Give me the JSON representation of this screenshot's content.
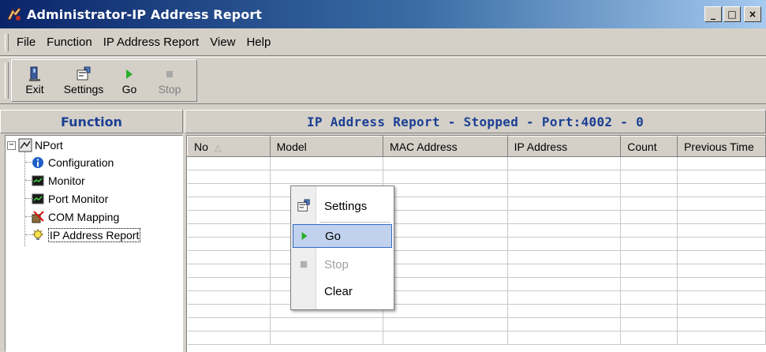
{
  "window": {
    "title": "Administrator-IP Address Report",
    "controls": {
      "minimize": "_",
      "maximize": "□",
      "close": "×"
    }
  },
  "menu": {
    "items": [
      {
        "label": "File",
        "accel": "F"
      },
      {
        "label": "Function",
        "accel": "F"
      },
      {
        "label": "IP Address Report",
        "accel": "I"
      },
      {
        "label": "View",
        "accel": "V"
      },
      {
        "label": "Help",
        "accel": "H"
      }
    ]
  },
  "toolbar": {
    "exit_label": "Exit",
    "settings_label": "Settings",
    "go_label": "Go",
    "stop_label": "Stop",
    "stop_disabled": true
  },
  "left_panel": {
    "header": "Function",
    "tree": {
      "root": "NPort",
      "expander": "−",
      "children": [
        {
          "label": "Configuration",
          "icon": "info-icon"
        },
        {
          "label": "Monitor",
          "icon": "monitor-icon"
        },
        {
          "label": "Port Monitor",
          "icon": "port-monitor-icon"
        },
        {
          "label": "COM Mapping",
          "icon": "com-mapping-icon"
        },
        {
          "label": "IP Address Report",
          "icon": "lightbulb-icon",
          "selected": true
        }
      ]
    }
  },
  "right_panel": {
    "header": "IP Address Report - Stopped - Port:4002 - 0",
    "columns": [
      "No",
      "Model",
      "MAC Address",
      "IP Address",
      "Count",
      "Previous Time"
    ],
    "sort_column": "No",
    "sort_indicator": "△",
    "rows": []
  },
  "context_menu": {
    "items": [
      {
        "label": "Settings",
        "accel": "S",
        "icon": "settings-icon",
        "disabled": false,
        "highlighted": false
      },
      {
        "label": "Go",
        "accel": "G",
        "icon": "play-icon",
        "disabled": false,
        "highlighted": true
      },
      {
        "label": "Stop",
        "accel": "t",
        "icon": "stop-icon",
        "disabled": true,
        "highlighted": false
      },
      {
        "label": "Clear",
        "accel": "C",
        "icon": "",
        "disabled": false,
        "highlighted": false
      }
    ]
  },
  "colors": {
    "title_gradient_start": "#0a246a",
    "title_gradient_end": "#a6caf0",
    "panel_header_text": "#1c3f94",
    "go_green": "#2bb02b",
    "menu_highlight": "#c1d2ee"
  }
}
